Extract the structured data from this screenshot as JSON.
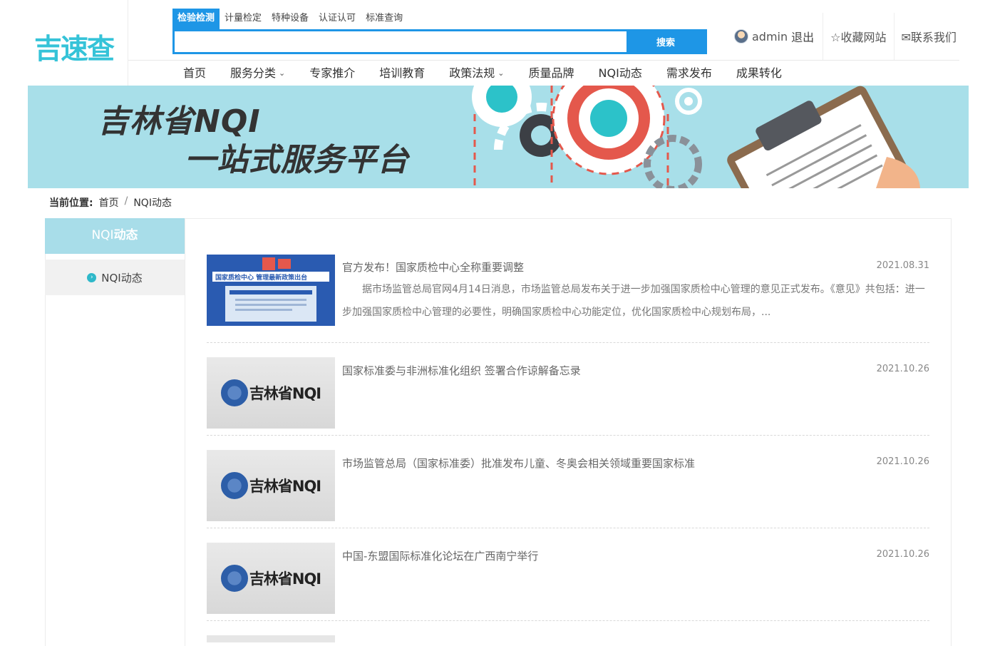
{
  "logo": "吉速查",
  "search": {
    "tabs": [
      "检验检测",
      "计量检定",
      "特种设备",
      "认证认可",
      "标准查询"
    ],
    "placeholder": "",
    "button": "搜索"
  },
  "user": {
    "name": "admin",
    "logout": "退出",
    "favorite": "☆收藏网站",
    "contact": "✉联系我们"
  },
  "nav": [
    {
      "label": "首页"
    },
    {
      "label": "服务分类",
      "dropdown": true
    },
    {
      "label": "专家推介"
    },
    {
      "label": "培训教育"
    },
    {
      "label": "政策法规",
      "dropdown": true
    },
    {
      "label": "质量品牌"
    },
    {
      "label": "NQI动态"
    },
    {
      "label": "需求发布"
    },
    {
      "label": "成果转化"
    }
  ],
  "banner": {
    "line1": "吉林省NQI",
    "line2": "一站式服务平台",
    "colors": {
      "background": "#a8dfe9",
      "accent": "#35c3d8"
    }
  },
  "breadcrumb": {
    "label": "当前位置:",
    "items": [
      "首页",
      "NQI动态"
    ]
  },
  "sidebar": {
    "title_prefix": "NQI",
    "title_suffix": "动态",
    "items": [
      "NQI动态"
    ]
  },
  "thumb_brand": "吉林省NQI",
  "thumb_banner_text": "国家质检中心 管理最新政策出台",
  "news": [
    {
      "title": "官方发布！国家质检中心全称重要调整",
      "date": "2021.08.31",
      "desc": "据市场监管总局官网4月14日消息，市场监管总局发布关于进一步加强国家质检中心管理的意见正式发布。《意见》共包括：进一步加强国家质检中心管理的必要性，明确国家质检中心功能定位，优化国家质检中心规划布局，..."
    },
    {
      "title": "国家标准委与非洲标准化组织 签署合作谅解备忘录",
      "date": "2021.10.26",
      "desc": ""
    },
    {
      "title": "市场监管总局（国家标准委）批准发布儿童、冬奥会相关领域重要国家标准",
      "date": "2021.10.26",
      "desc": ""
    },
    {
      "title": "中国-东盟国际标准化论坛在广西南宁举行",
      "date": "2021.10.26",
      "desc": ""
    }
  ]
}
